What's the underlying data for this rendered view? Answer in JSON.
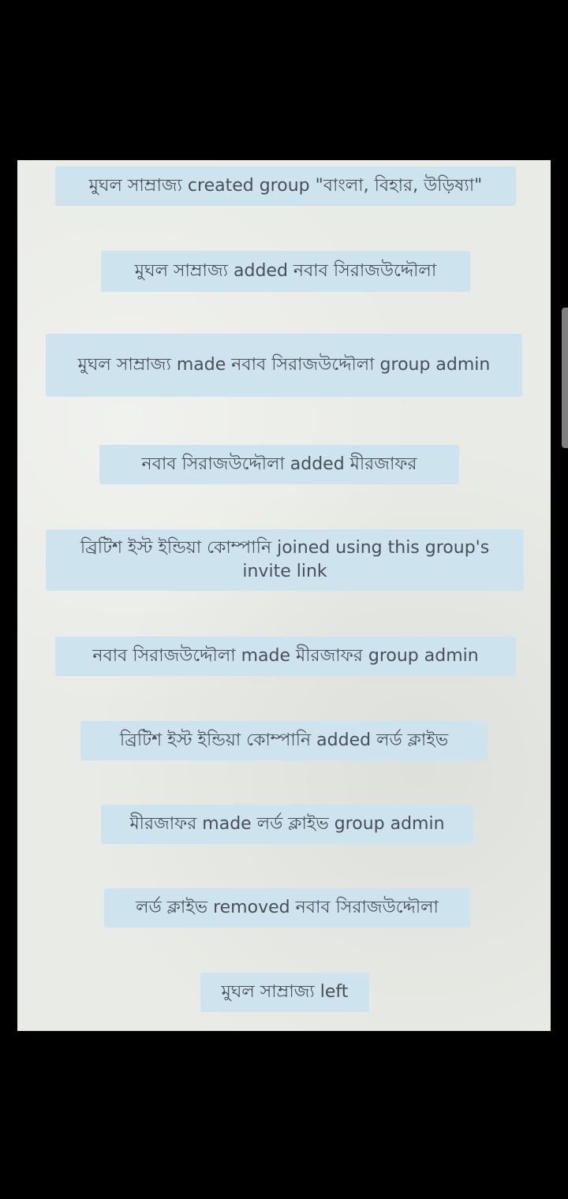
{
  "system_messages": [
    "মুঘল সাম্রাজ্য created group \"বাংলা, বিহার, উড়িষ্যা\"",
    "মুঘল সাম্রাজ্য added নবাব সিরাজউদ্দৌলা",
    "মুঘল সাম্রাজ্য made নবাব সিরাজউদ্দৌলা group admin",
    "নবাব সিরাজউদ্দৌলা added মীরজাফর",
    "ব্রিটিশ ইস্ট ইন্ডিয়া কোম্পানি joined using this group's invite link",
    "নবাব সিরাজউদ্দৌলা made মীরজাফর group admin",
    "ব্রিটিশ ইস্ট ইন্ডিয়া কোম্পানি added লর্ড ক্লাইভ",
    "মীরজাফর made লর্ড ক্লাইভ group admin",
    "লর্ড ক্লাইভ removed নবাব সিরাজউদ্দৌলা",
    "মুঘল সাম্রাজ্য left"
  ],
  "colors": {
    "screen_background": "#000000",
    "chat_background": "#e9ebe6",
    "bubble_background": "#cde4ef",
    "bubble_text": "#4a4f55",
    "scrollbar": "#7f7f7f"
  }
}
